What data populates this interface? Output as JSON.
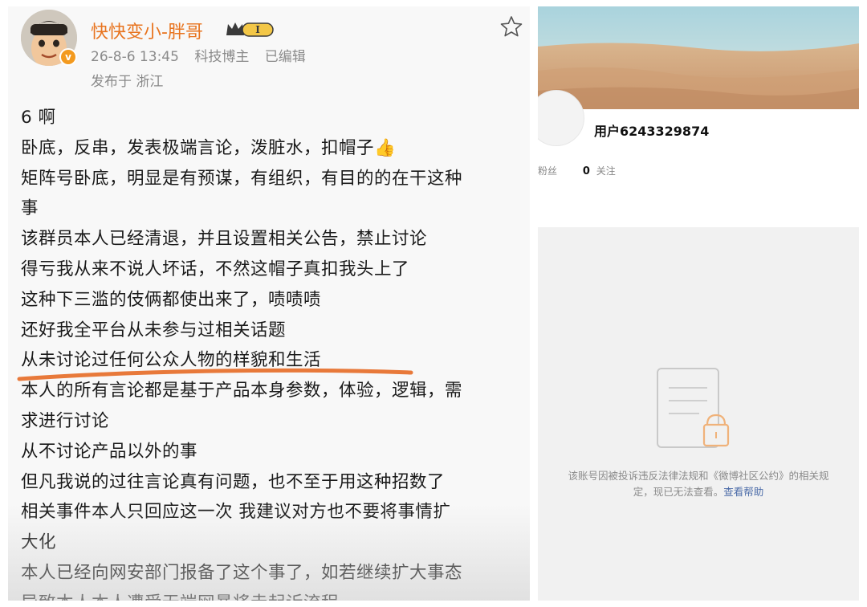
{
  "post": {
    "author": "快快变小-胖哥",
    "vip_level": "I",
    "date": "26-8-6 13:45",
    "category": "科技博主",
    "edited": "已编辑",
    "location": "发布于 浙江",
    "lines": [
      "6 啊",
      "卧底，反串，发表极端言论，泼脏水，扣帽子👍",
      "矩阵号卧底，明显是有预谋，有组织，有目的的在干这种",
      "事",
      "该群员本人已经清退，并且设置相关公告，禁止讨论",
      "得亏我从来不说人坏话，不然这帽子真扣我头上了",
      "这种下三滥的伎俩都使出来了，啧啧啧",
      "还好我全平台从未参与过相关话题",
      "从未讨论过任何公众人物的样貌和生活",
      "本人的所有言论都是基于产品本身参数，体验，逻辑，需",
      "求进行讨论",
      "从不讨论产品以外的事",
      "但凡我说的过往言论真有问题，也不至于用这种招数了",
      "相关事件本人只回应这一次 我建议对方也不要将事情扩",
      "大化",
      "本人已经向网安部门报备了这个事了，如若继续扩大事态",
      "导致本人本人遭受无端网暴将走起诉流程"
    ]
  },
  "profile": {
    "username": "用户6243329874",
    "fans_label": "粉丝",
    "follow_count": "0",
    "follow_label": "关注",
    "notice_line1": "该账号因被投诉违反法律法规和《微博社区公约》的相关规",
    "notice_line2": "定，现已无法查看。",
    "help_link": "查看帮助"
  },
  "colors": {
    "author": "#e8741f",
    "underline": "#e8793a",
    "link": "#4b6ba8"
  }
}
